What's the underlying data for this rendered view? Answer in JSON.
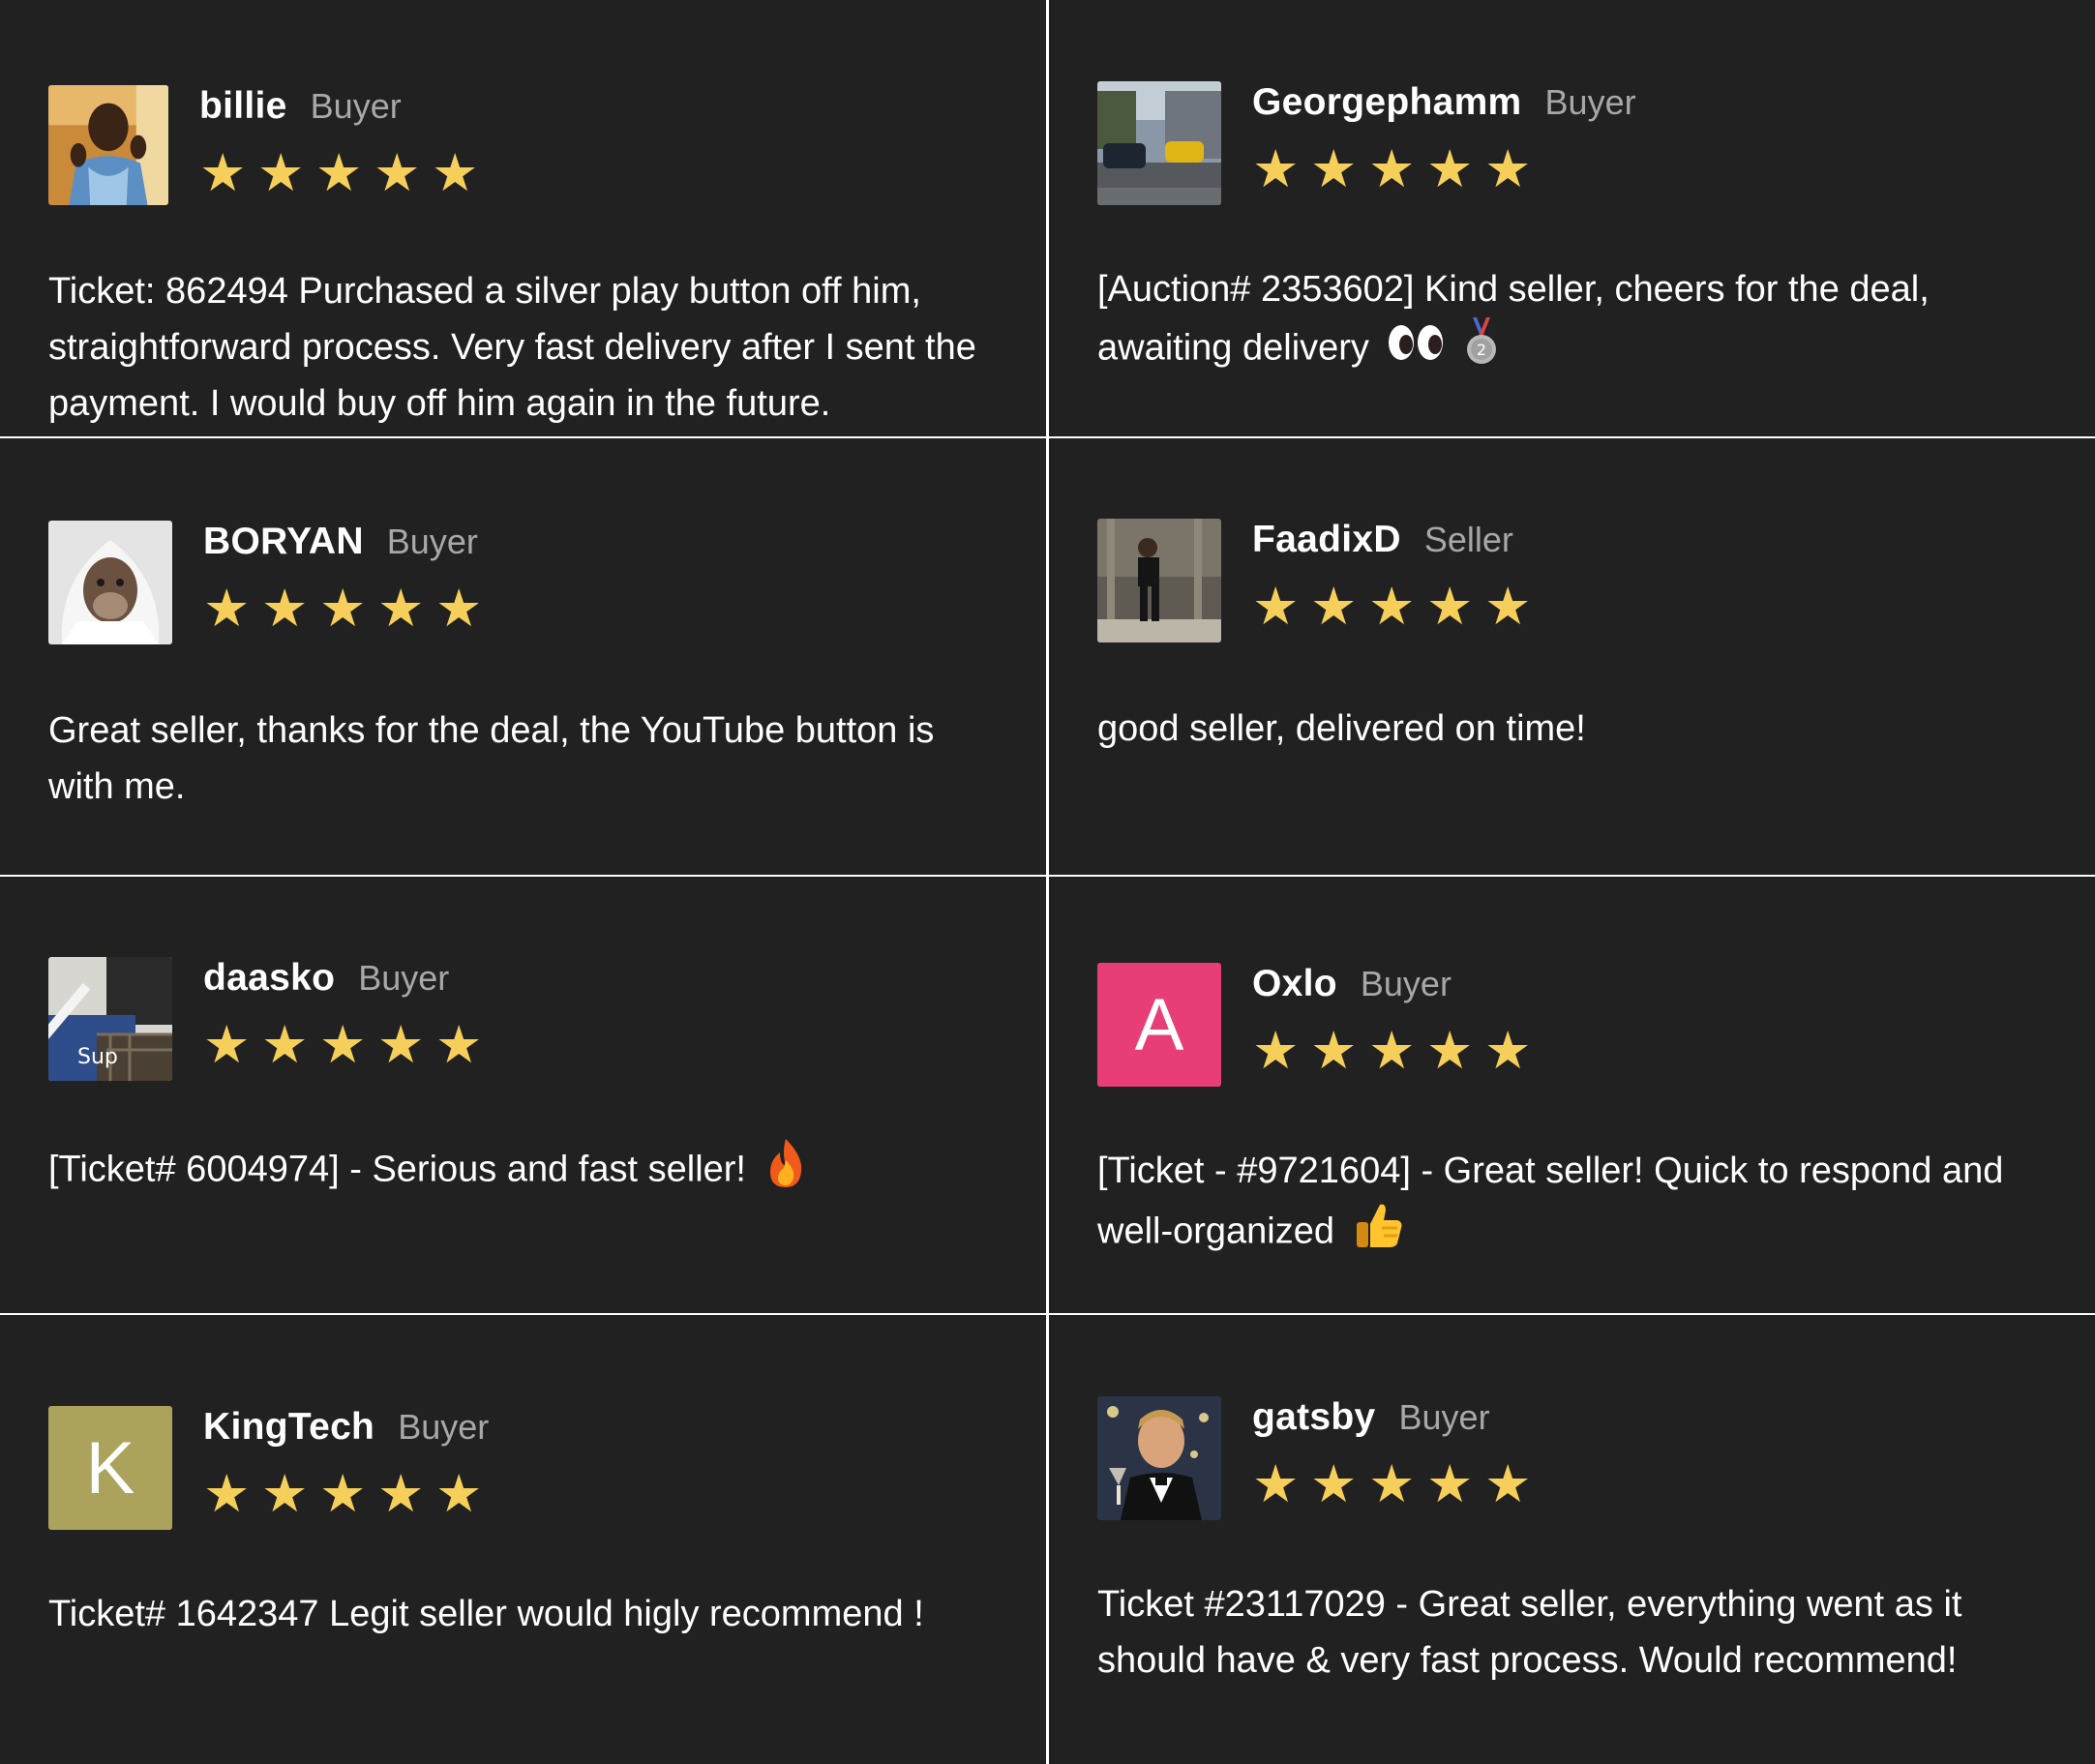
{
  "reviews": [
    {
      "name": "billie",
      "role": "Buyer",
      "rating": 5,
      "avatar": "photo-man-blue-jersey",
      "text": "Ticket: 862494 Purchased a silver play button off him, straightforward process. Very fast delivery after I sent the payment. I would buy off him again in the future."
    },
    {
      "name": "Georgephamm",
      "role": "Buyer",
      "rating": 5,
      "avatar": "photo-cars-street",
      "text": "[Auction# 2353602] Kind seller, cheers for the deal, awaiting delivery",
      "emoji": [
        "eyes-icon",
        "silver-medal-icon"
      ]
    },
    {
      "name": "BORYAN",
      "role": "Buyer",
      "rating": 5,
      "avatar": "photo-ape-hoodie",
      "text": "Great seller, thanks for the deal, the YouTube button is with me."
    },
    {
      "name": "FaadixD",
      "role": "Seller",
      "rating": 5,
      "avatar": "photo-man-standing",
      "text": "good seller, delivered on time!"
    },
    {
      "name": "daasko",
      "role": "Buyer",
      "rating": 5,
      "avatar": "photo-bag-pattern",
      "text": "[Ticket# 6004974] - Serious and fast seller!",
      "emoji": [
        "fire-icon"
      ]
    },
    {
      "name": "Oxlo",
      "role": "Buyer",
      "rating": 5,
      "avatar_letter": "A",
      "avatar_color": "#e83e78",
      "text": "[Ticket - #9721604] - Great seller! Quick to respond and well-organized",
      "emoji": [
        "thumbs-up-icon"
      ]
    },
    {
      "name": "KingTech",
      "role": "Buyer",
      "rating": 5,
      "avatar_letter": "K",
      "avatar_color": "#aba35b",
      "text": "Ticket# 1642347 Legit seller would higly recommend !"
    },
    {
      "name": "gatsby",
      "role": "Buyer",
      "rating": 5,
      "avatar": "photo-man-toast",
      "text": "Ticket #23117029 - Great seller, everything went as it should have & very fast process. Would recommend!"
    }
  ],
  "star_glyph": "★",
  "colors": {
    "card_bg": "#212121",
    "divider": "#ffffff",
    "star": "#f6cf5b",
    "role_text": "#a8a8a8"
  }
}
